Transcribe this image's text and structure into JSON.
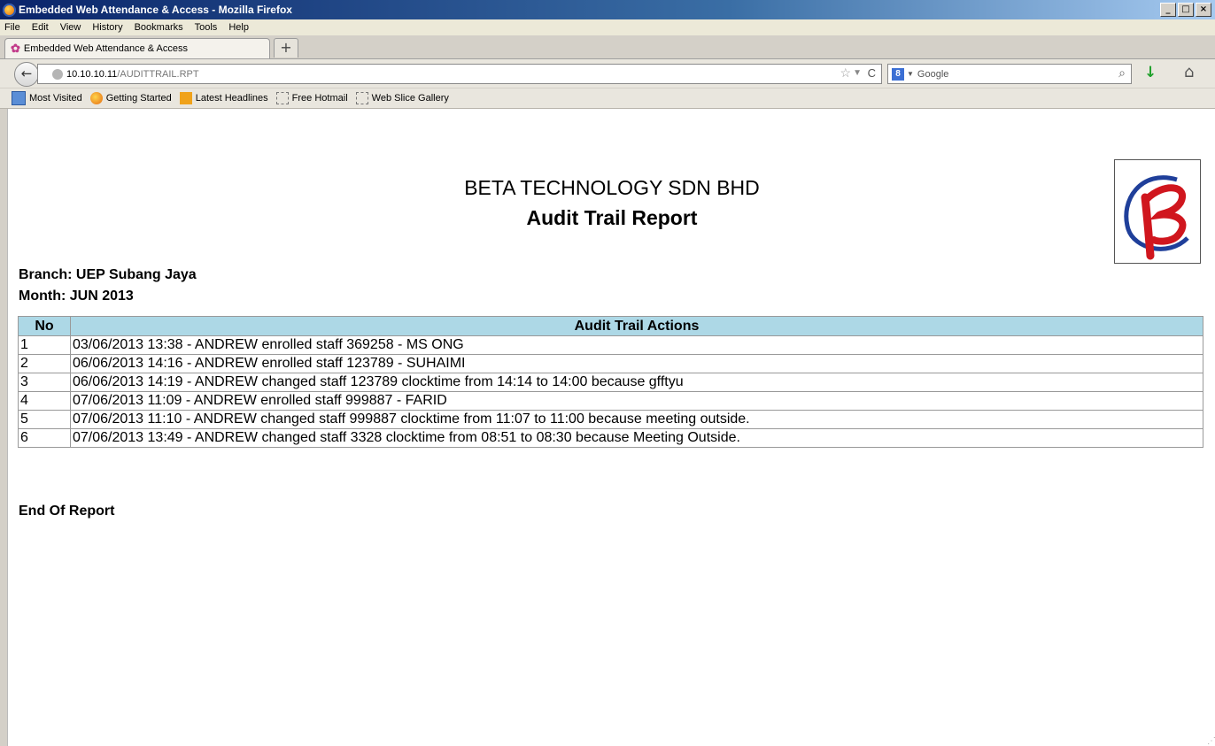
{
  "window": {
    "title": "Embedded Web Attendance & Access - Mozilla Firefox",
    "buttons": {
      "minimize": "_",
      "maximize": "□",
      "close": "×"
    }
  },
  "menu": [
    "File",
    "Edit",
    "View",
    "History",
    "Bookmarks",
    "Tools",
    "Help"
  ],
  "tab": {
    "label": "Embedded Web Attendance & Access",
    "icon": "page-favicon",
    "new_tab": "+"
  },
  "nav": {
    "url_host": "10.10.10.11",
    "url_path": "/AUDITTRAIL.RPT",
    "search_engine_icon": "google-icon",
    "search_placeholder": "Google"
  },
  "bookmarks": [
    {
      "label": "Most Visited",
      "icon": "most-visited-icon"
    },
    {
      "label": "Getting Started",
      "icon": "firefox-icon"
    },
    {
      "label": "Latest Headlines",
      "icon": "rss-icon"
    },
    {
      "label": "Free Hotmail",
      "icon": "web-slice-icon"
    },
    {
      "label": "Web Slice Gallery",
      "icon": "web-slice-icon"
    }
  ],
  "report": {
    "company": "BETA TECHNOLOGY SDN BHD",
    "title": "Audit Trail Report",
    "branch": "Branch: UEP Subang Jaya",
    "month": "Month: JUN 2013",
    "columns": {
      "no": "No",
      "actions": "Audit Trail Actions"
    },
    "rows": [
      {
        "no": "1",
        "action": "03/06/2013 13:38 - ANDREW enrolled staff 369258 - MS ONG"
      },
      {
        "no": "2",
        "action": "06/06/2013 14:16 - ANDREW enrolled staff 123789 - SUHAIMI"
      },
      {
        "no": "3",
        "action": "06/06/2013 14:19 - ANDREW changed staff 123789 clocktime from 14:14 to 14:00 because gfftyu"
      },
      {
        "no": "4",
        "action": "07/06/2013 11:09 - ANDREW enrolled staff 999887 - FARID"
      },
      {
        "no": "5",
        "action": "07/06/2013 11:10 - ANDREW changed staff 999887 clocktime from 11:07 to 11:00 because meeting outside."
      },
      {
        "no": "6",
        "action": "07/06/2013 13:49 - ANDREW changed staff 3328 clocktime from 08:51 to 08:30 because Meeting Outside."
      }
    ],
    "footer": "End Of Report",
    "header_color": "#add8e6",
    "logo_colors": {
      "ring": "#1f3f9a",
      "letter": "#d0161e"
    }
  }
}
